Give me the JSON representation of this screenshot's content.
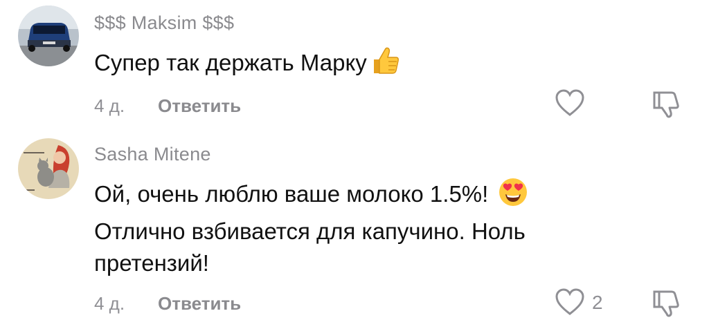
{
  "comments": [
    {
      "username": "$$$ Maksim $$$",
      "text": "Супер так держать Марку",
      "emoji_icon": "thumbs-up-emoji",
      "time": "4 д.",
      "reply_label": "Ответить",
      "like_count": ""
    },
    {
      "username": "Sasha Mitene",
      "text": "Ой, очень люблю ваше молоко 1.5%!",
      "text_line2": "Отлично взбивается для капучино. Ноль претензий!",
      "emoji_icon": "heart-eyes-emoji",
      "time": "4 д.",
      "reply_label": "Ответить",
      "like_count": "2"
    }
  ],
  "colors": {
    "muted_text": "#8f8f94",
    "main_text": "#111111",
    "background": "#ffffff"
  }
}
